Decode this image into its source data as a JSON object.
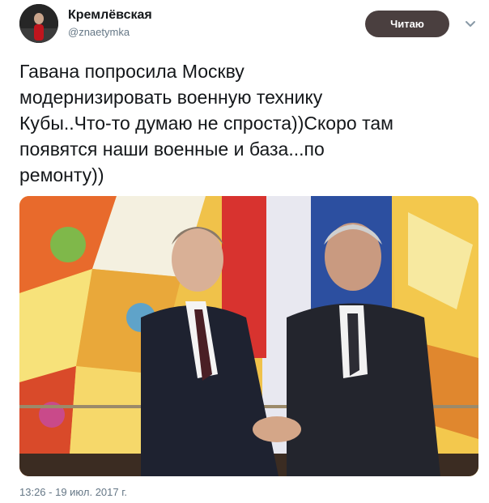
{
  "tweet": {
    "author": {
      "name": "Кремлёвская",
      "handle": "@znaetymka",
      "avatar_icon": "avatar-photo"
    },
    "follow_button_label": "Читаю",
    "menu_icon": "chevron-down-icon",
    "text_lines": [
      "Гавана попросила Москву",
      "модернизировать военную технику",
      "Кубы..Что-то думаю не спроста))Скоро там",
      "появятся наши военные и база...по",
      "ремонту))"
    ],
    "media_icon": "photo-handshake-image",
    "timestamp": "13:26 - 19 июл. 2017 г."
  },
  "colors": {
    "follow_button_bg": "#4a3f3f",
    "secondary_text": "#657786",
    "primary_text": "#14171a"
  }
}
